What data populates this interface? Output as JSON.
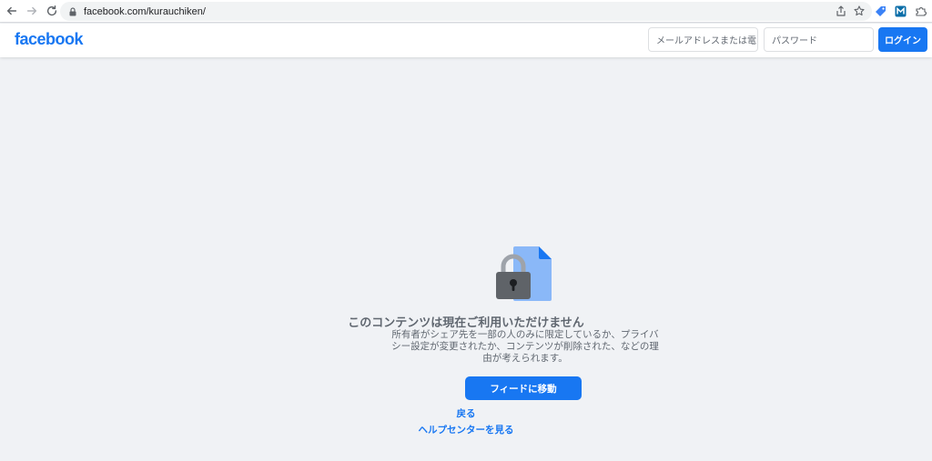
{
  "browser": {
    "url": "facebook.com/kurauchiken/",
    "icons": [
      "back-arrow-icon",
      "forward-arrow-icon",
      "reload-icon",
      "lock-icon",
      "share-icon",
      "star-icon",
      "extension-icon"
    ]
  },
  "header": {
    "logo": "facebook",
    "email_placeholder": "メールアドレスまたは電",
    "password_placeholder": "パスワード",
    "login_label": "ログイン"
  },
  "content": {
    "title": "このコンテンツは現在ご利用いただけません",
    "description": "所有者がシェア先を一部の人のみに限定しているか、プライバシー設定が変更されたか、コンテンツが削除された、などの理由が考えられます。",
    "feed_button": "フィードに移動",
    "back_link": "戻る",
    "help_link": "ヘルプセンターを見る"
  },
  "colors": {
    "brand": "#1877f2",
    "background": "#f0f2f5",
    "text_secondary": "#606770"
  }
}
